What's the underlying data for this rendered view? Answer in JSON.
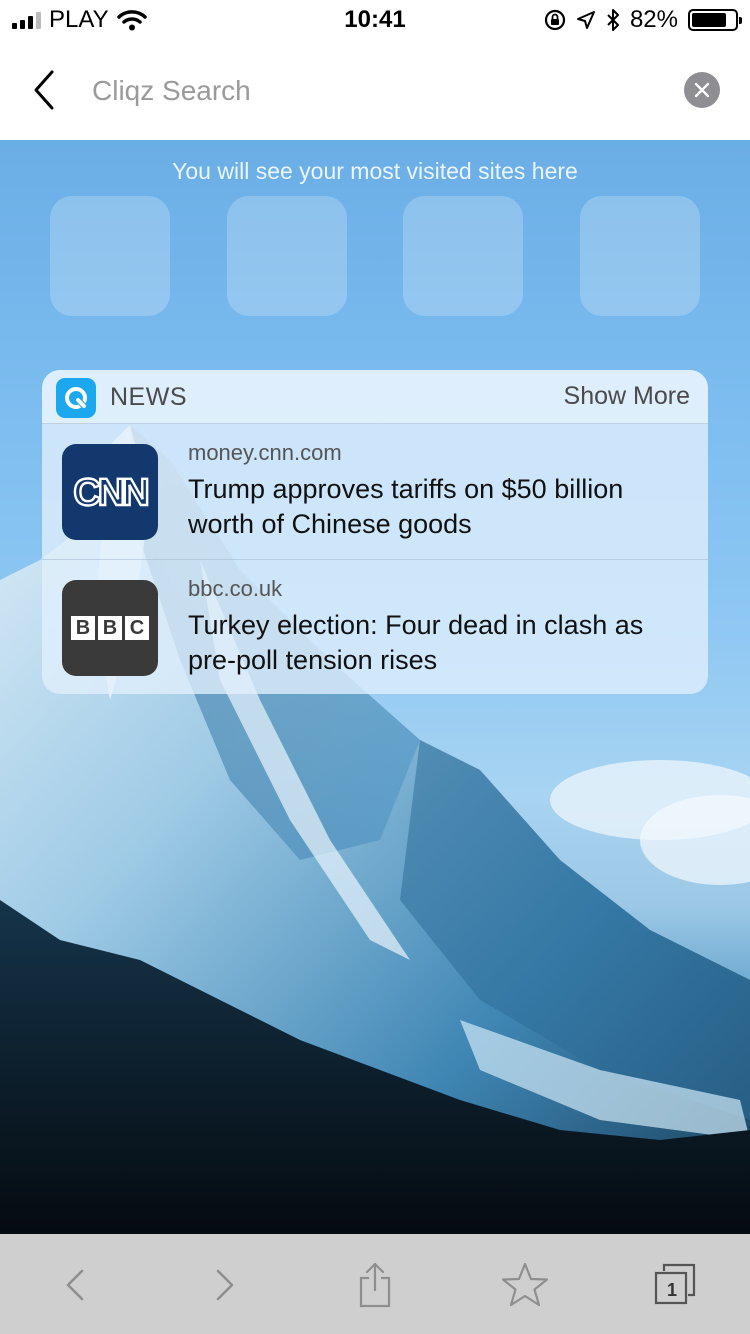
{
  "status_bar": {
    "carrier": "PLAY",
    "time": "10:41",
    "battery_percent": "82%",
    "battery_level": 0.82
  },
  "header": {
    "search_placeholder": "Cliqz Search",
    "back_icon": "chevron-left-icon",
    "clear_icon": "close-icon"
  },
  "top_sites": {
    "caption": "You will see your most visited sites here",
    "tiles": [
      {},
      {},
      {},
      {}
    ]
  },
  "news": {
    "title": "NEWS",
    "show_more_label": "Show More",
    "items": [
      {
        "domain": "money.cnn.com",
        "headline": "Trump approves tariffs on $50 billion worth of Chinese goods",
        "logo_text": "CNN",
        "logo_color": "#13386e"
      },
      {
        "domain": "bbc.co.uk",
        "headline": "Turkey election: Four dead in clash as pre-poll tension rises",
        "logo_letters": [
          "B",
          "B",
          "C"
        ],
        "logo_color": "#3a3a3a"
      }
    ]
  },
  "toolbar": {
    "tabs_count": "1",
    "icons": [
      "back-icon",
      "forward-icon",
      "share-icon",
      "star-icon",
      "tabs-icon"
    ]
  },
  "colors": {
    "accent": "#1ca8ee",
    "toolbar_bg": "#cfcfcf"
  }
}
